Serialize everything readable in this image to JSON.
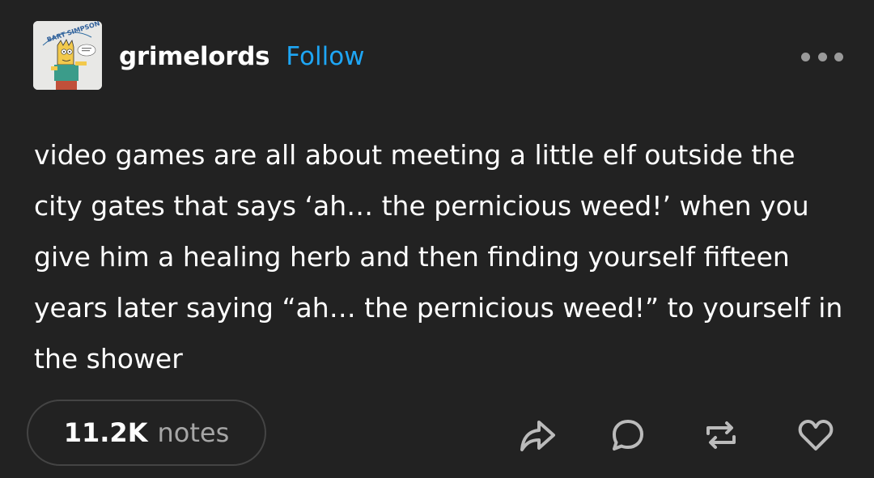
{
  "post": {
    "avatar": {
      "icon": "bart-simpson-shirt-avatar",
      "text": "BART SIMPSON"
    },
    "username": "grimelords",
    "follow_label": "Follow",
    "more_icon": "ellipsis-icon",
    "body": "video games are all about meeting a little elf outside the city gates that says ‘ah… the pernicious weed!’ when you give him a healing herb and then finding yourself fifteen years later saying “ah… the pernicious weed!” to yourself in the shower",
    "notes": {
      "count": "11.2K",
      "label": "notes"
    },
    "actions": [
      "share-icon",
      "reply-icon",
      "reblog-icon",
      "like-icon"
    ]
  },
  "colors": {
    "background": "#222222",
    "text": "#ffffff",
    "accent": "#1ea6f5",
    "muted": "#a6a6a6",
    "icon": "#bbbbbb"
  }
}
